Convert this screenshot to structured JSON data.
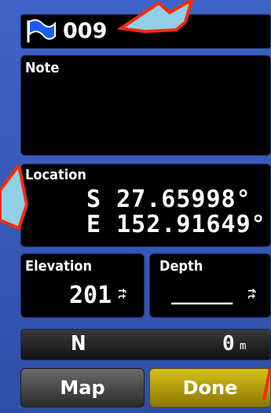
{
  "header": {
    "name": "009",
    "icon": "waypoint-flag-icon"
  },
  "note": {
    "label": "Note",
    "value": ""
  },
  "location": {
    "label": "Location",
    "lat": "S  27.65998°",
    "lon": "E 152.91649°"
  },
  "elevation": {
    "label": "Elevation",
    "value": "201",
    "unit": "ft"
  },
  "depth": {
    "label": "Depth",
    "value": "_____",
    "unit": "ft"
  },
  "proximity": {
    "direction": "N",
    "distance": "0",
    "unit": "m"
  },
  "buttons": {
    "map": "Map",
    "done": "Done"
  },
  "colors": {
    "background": "#3b5ebf",
    "panel": "#000000",
    "done_button": "#b59a00",
    "map_button": "#4a4a4a",
    "annotation_arrow": "#8fd0e6",
    "annotation_outline": "#ff2a00"
  }
}
